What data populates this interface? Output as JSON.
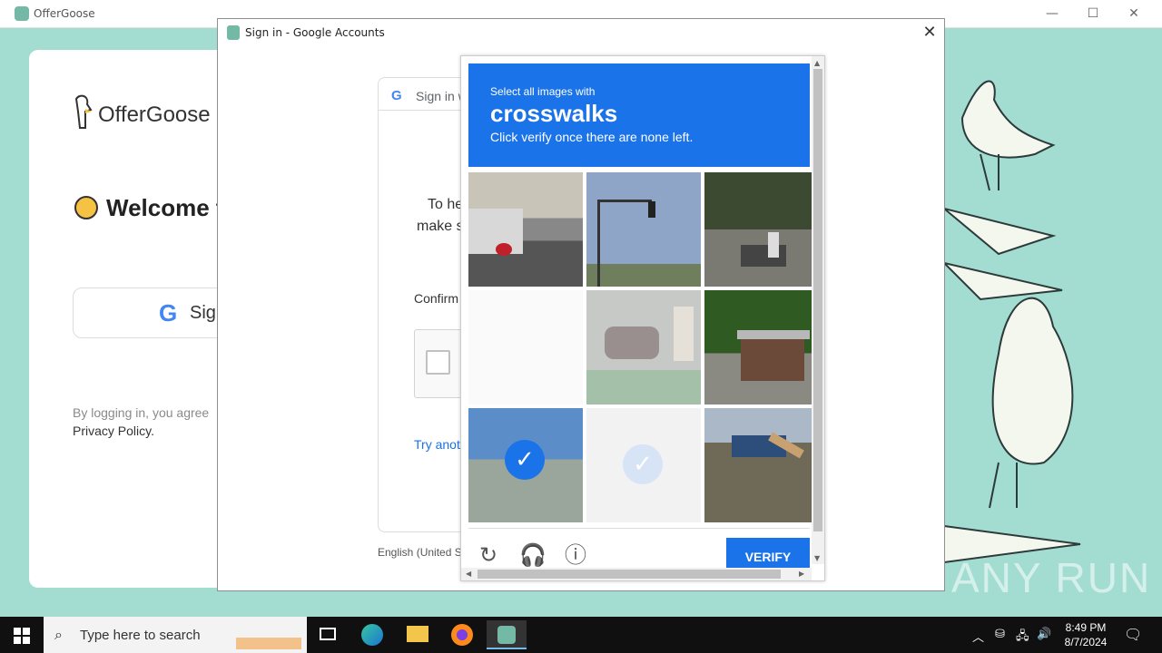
{
  "app": {
    "title": "OfferGoose"
  },
  "page": {
    "brand": "OfferGoose",
    "welcome": "Welcome to",
    "google_button": "Sign",
    "terms_line": "By logging in, you agree",
    "privacy": "Privacy Policy."
  },
  "popup": {
    "title": "Sign in - Google Accounts",
    "close": "✕",
    "sign_in": "Sign in w",
    "to_help": "To he",
    "make_sure": "make s",
    "confirm": "Confirm",
    "try_another": "Try anot",
    "language": "English (United S"
  },
  "captcha": {
    "instruction_top": "Select all images with",
    "target": "crosswalks",
    "instruction_bottom": "Click verify once there are none left.",
    "verify": "VERIFY",
    "tiles": [
      {
        "scene": "truck",
        "selected": false
      },
      {
        "scene": "traffic-light",
        "selected": false
      },
      {
        "scene": "motorbike-trees",
        "selected": false
      },
      {
        "scene": "faded",
        "selected": false
      },
      {
        "scene": "motorbike-wall",
        "selected": false
      },
      {
        "scene": "building-trees",
        "selected": false
      },
      {
        "scene": "bridge",
        "selected": true
      },
      {
        "scene": "faded",
        "selected": true
      },
      {
        "scene": "motorbike-road",
        "selected": false
      }
    ]
  },
  "taskbar": {
    "search_placeholder": "Type here to search",
    "time": "8:49 PM",
    "date": "8/7/2024"
  },
  "watermark": "ANY RUN",
  "colors": {
    "accent": "#1a73e8",
    "bg_teal": "#a3ddd2"
  }
}
